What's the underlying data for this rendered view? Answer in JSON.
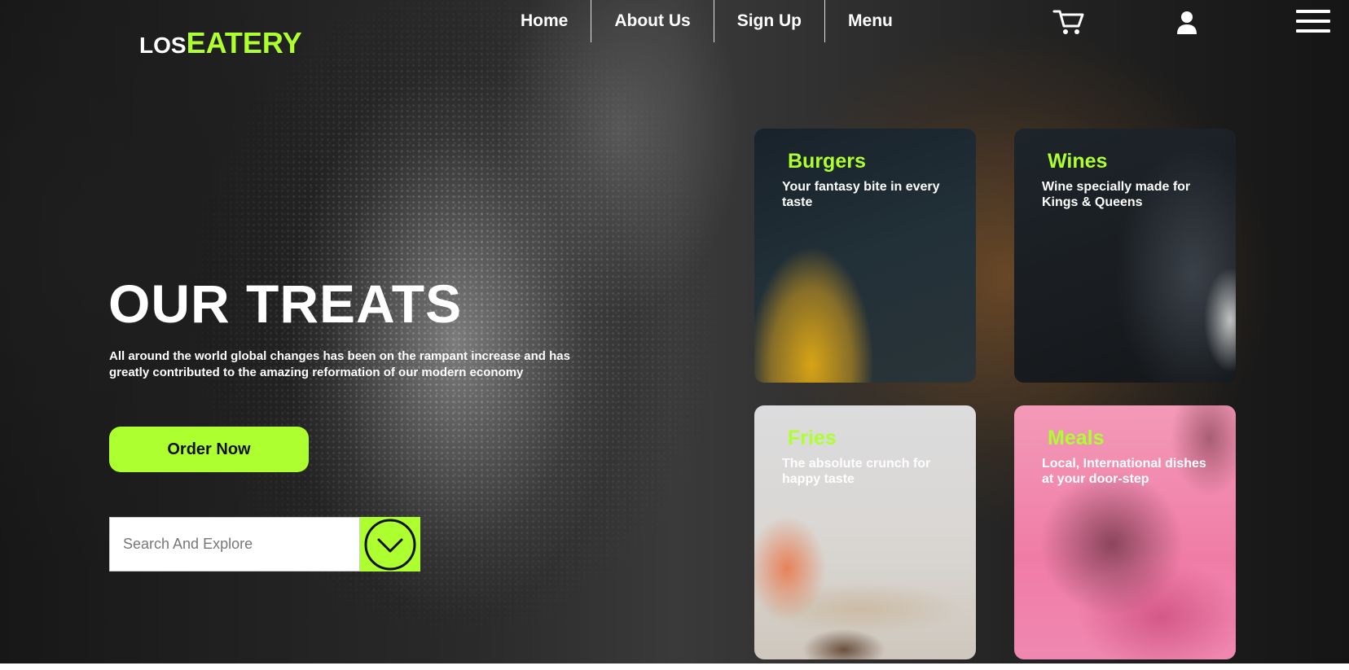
{
  "brand": {
    "prefix": "LOS",
    "name": "EATERY"
  },
  "nav": {
    "items": [
      {
        "label": "Home"
      },
      {
        "label": "About Us"
      },
      {
        "label": "Sign Up"
      },
      {
        "label": "Menu"
      }
    ]
  },
  "icons": {
    "cart": "cart-icon",
    "user": "user-icon",
    "menu": "hamburger-menu-icon",
    "search_submit": "chevron-down-circle-icon"
  },
  "hero": {
    "title": "OUR TREATS",
    "text": "All around the world global changes has been on the rampant increase and has greatly contributed to the amazing reformation of our modern economy",
    "order_button": "Order Now",
    "search_placeholder": "Search And Explore"
  },
  "cards": [
    {
      "title": "Burgers",
      "desc": "Your fantasy bite in every taste"
    },
    {
      "title": "Wines",
      "desc": "Wine specially made for Kings & Queens"
    },
    {
      "title": "Fries",
      "desc": "The absolute crunch for happy taste"
    },
    {
      "title": "Meals",
      "desc": "Local, International dishes at your door-step"
    }
  ],
  "colors": {
    "accent": "#adff2f",
    "background": "#1b1b1b",
    "text": "#ffffff"
  }
}
